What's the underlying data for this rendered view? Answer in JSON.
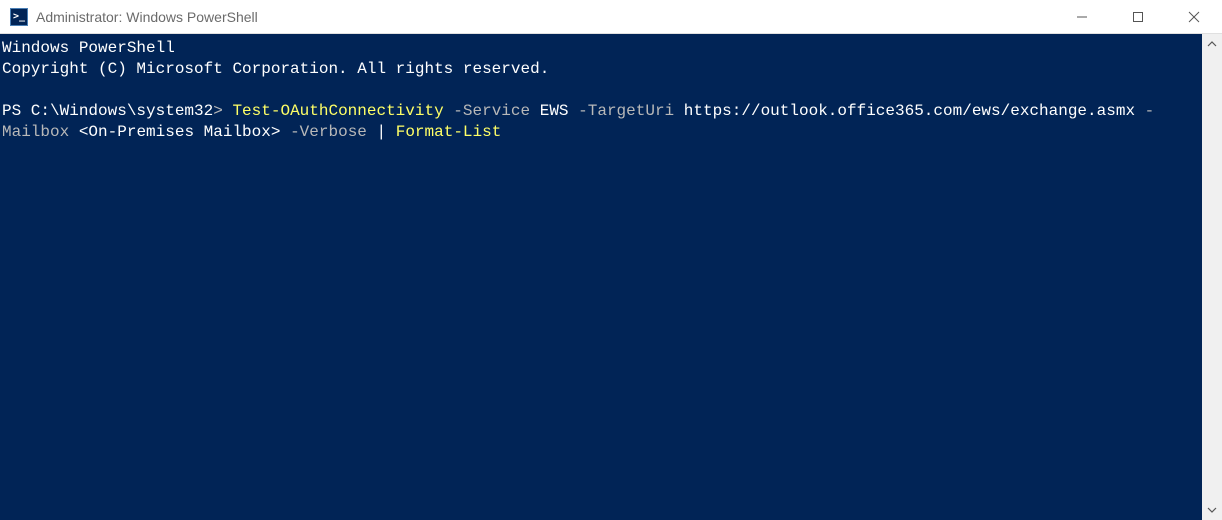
{
  "window": {
    "title": "Administrator: Windows PowerShell",
    "icon_label": ">_"
  },
  "terminal": {
    "banner_line1": "Windows PowerShell",
    "banner_line2": "Copyright (C) Microsoft Corporation. All rights reserved.",
    "prompt_prefix": "PS C:\\Windows\\system32",
    "prompt_arrow": ">",
    "command": {
      "cmdlet": "Test-OAuthConnectivity",
      "param_service": "-Service",
      "arg_service": "EWS",
      "param_targeturi": "-TargetUri",
      "arg_targeturi": "https://outlook.office365.com/ews/exchange.asmx",
      "param_mailbox_dash": "-",
      "param_mailbox_rest": "Mailbox",
      "arg_mailbox": "<On-Premises Mailbox>",
      "param_verbose": "-Verbose",
      "pipe": "|",
      "cmdlet2": "Format-List"
    }
  }
}
